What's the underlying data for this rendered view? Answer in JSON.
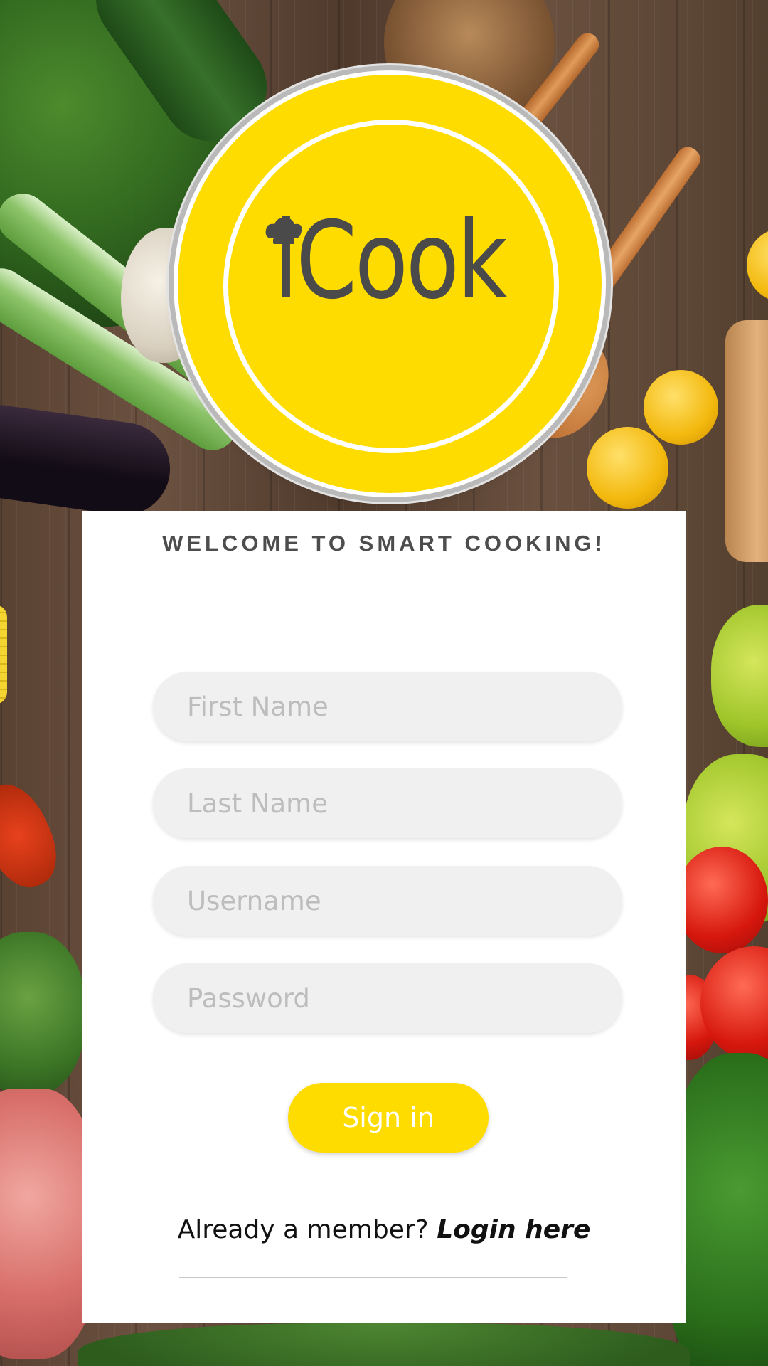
{
  "app": {
    "logo_text": "iCook"
  },
  "form": {
    "welcome": "WELCOME TO SMART COOKING!",
    "first_name_placeholder": "First Name",
    "last_name_placeholder": "Last Name",
    "username_placeholder": "Username",
    "password_placeholder": "Password",
    "signin_label": "Sign in",
    "member_prompt": "Already a member? ",
    "login_link": "Login here"
  },
  "colors": {
    "accent": "#ffdc00",
    "card": "#ffffff",
    "field_bg": "#f0f0f0",
    "placeholder": "#bdbdbd"
  }
}
